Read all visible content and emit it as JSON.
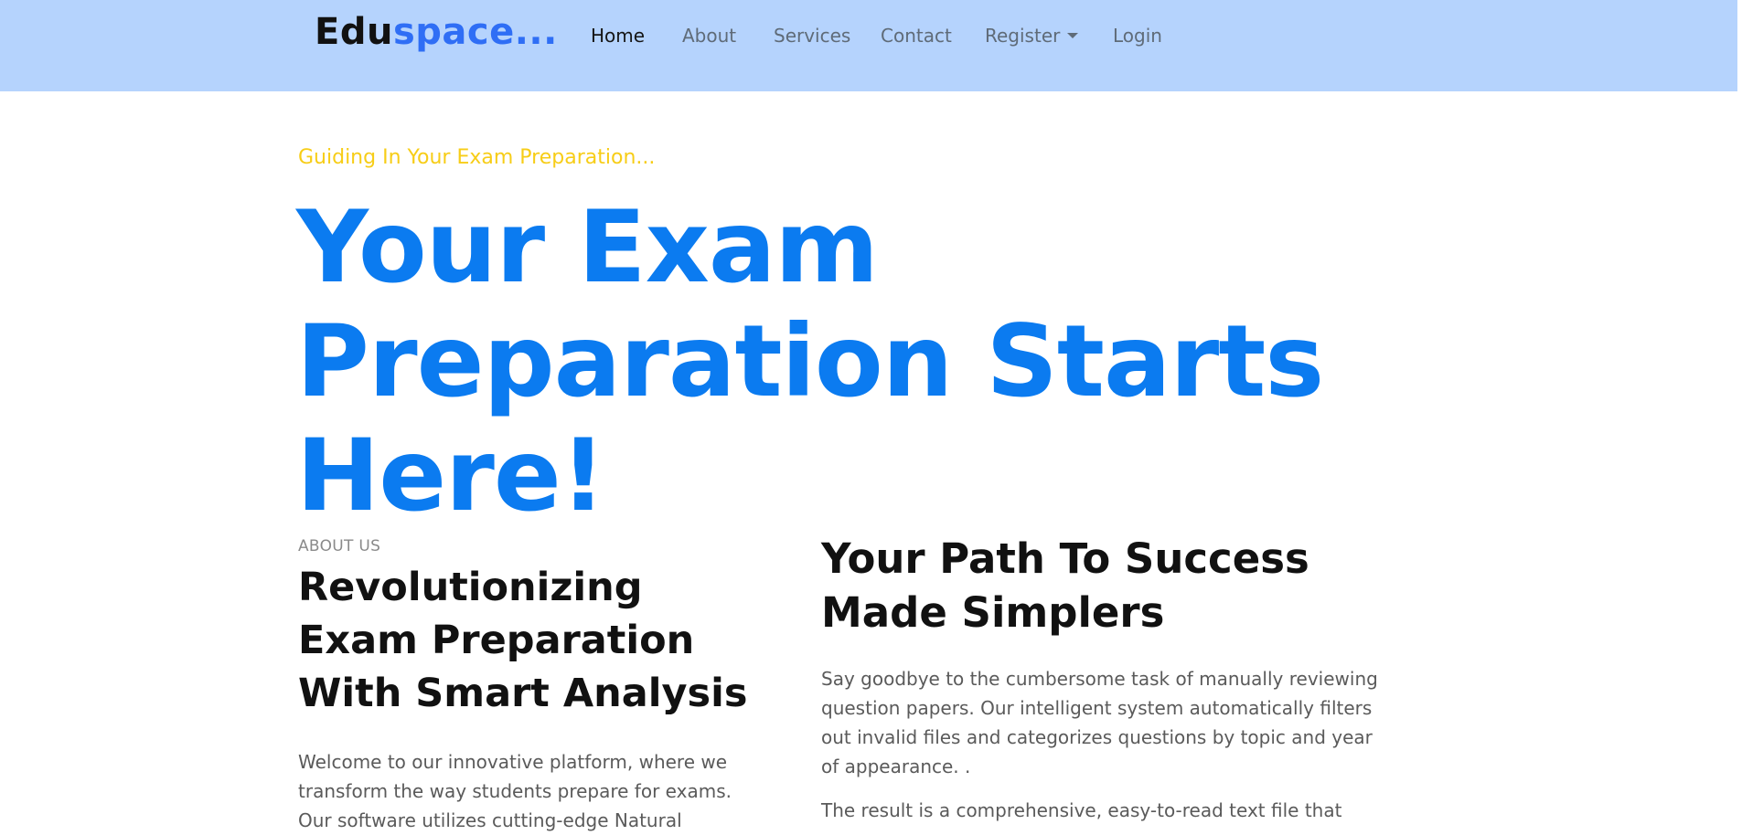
{
  "navbar": {
    "brand_part1": "Edu",
    "brand_part2": "space...",
    "items": [
      {
        "label": "Home",
        "active": true
      },
      {
        "label": "About"
      },
      {
        "label": "Services"
      },
      {
        "label": "Contact"
      },
      {
        "label": "Register"
      },
      {
        "label": "Login"
      }
    ]
  },
  "hero": {
    "subtitle": "Guiding In Your Exam Preparation...",
    "title": "Your Exam Preparation Starts Here!"
  },
  "about": {
    "kicker": "ABOUT US",
    "title": "Revolutionizing Exam Preparation With Smart Analysis",
    "text": "Welcome to our innovative platform, where we transform the way students prepare for exams. Our software utilizes cutting-edge Natural"
  },
  "path": {
    "title": "Your Path To Success Made Simplers",
    "text1": "Say goodbye to the cumbersome task of manually reviewing question papers. Our intelligent system automatically filters out invalid files and categorizes questions by topic and year of appearance. .",
    "text2": "The result is a comprehensive, easy-to-read text file that"
  },
  "colors": {
    "navbar_bg": "#b5d3fd",
    "brand_accent": "#2f6ef5",
    "hero_title": "#0b7bf0",
    "subtitle": "#f7cd17"
  }
}
